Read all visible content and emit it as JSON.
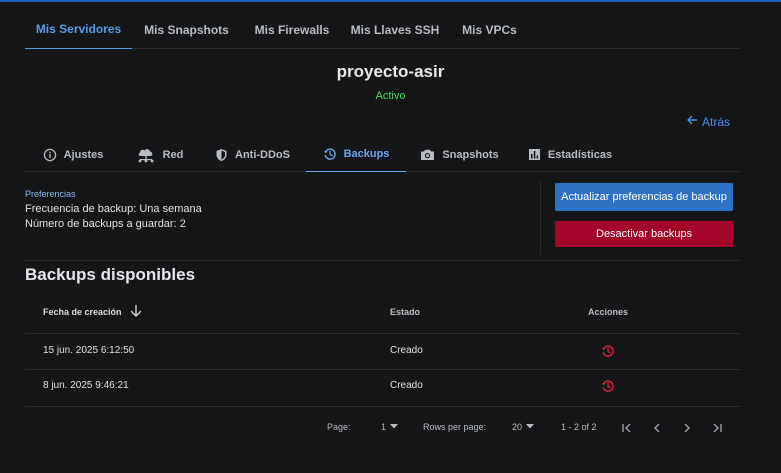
{
  "top_nav": {
    "tabs": [
      "Mis Servidores",
      "Mis Snapshots",
      "Mis Firewalls",
      "Mis Llaves SSH",
      "Mis VPCs"
    ]
  },
  "server": {
    "name": "proyecto-asir",
    "status": "Activo"
  },
  "back_label": "Atrás",
  "sub_nav": {
    "tabs": [
      "Ajustes",
      "Red",
      "Anti-DDoS",
      "Backups",
      "Snapshots",
      "Estadísticas"
    ],
    "active": "Backups"
  },
  "preferences": {
    "label": "Preferencias",
    "frequency": "Frecuencia de backup: Una semana",
    "count": "Número de backups a guardar: 2"
  },
  "buttons": {
    "update": "Actualizar preferencias de backup",
    "disable": "Desactivar backups"
  },
  "backups": {
    "title": "Backups disponibles",
    "columns": [
      "Fecha de creación",
      "Estado",
      "Acciones"
    ],
    "rows": [
      {
        "date": "15 jun. 2025 6:12:50",
        "state": "Creado"
      },
      {
        "date": "8 jun. 2025 9:46:21",
        "state": "Creado"
      }
    ]
  },
  "pagination": {
    "page_label": "Page:",
    "page_value": "1",
    "rows_label": "Rows per page:",
    "rows_value": "20",
    "range": "1 - 2 of 2"
  },
  "colors": {
    "background": "#151617",
    "accent": "#5a9be6",
    "status_green": "#52d65a",
    "primary_button": "#2e72c6",
    "danger_button": "#a4062a",
    "restore_icon": "#e0233f"
  }
}
